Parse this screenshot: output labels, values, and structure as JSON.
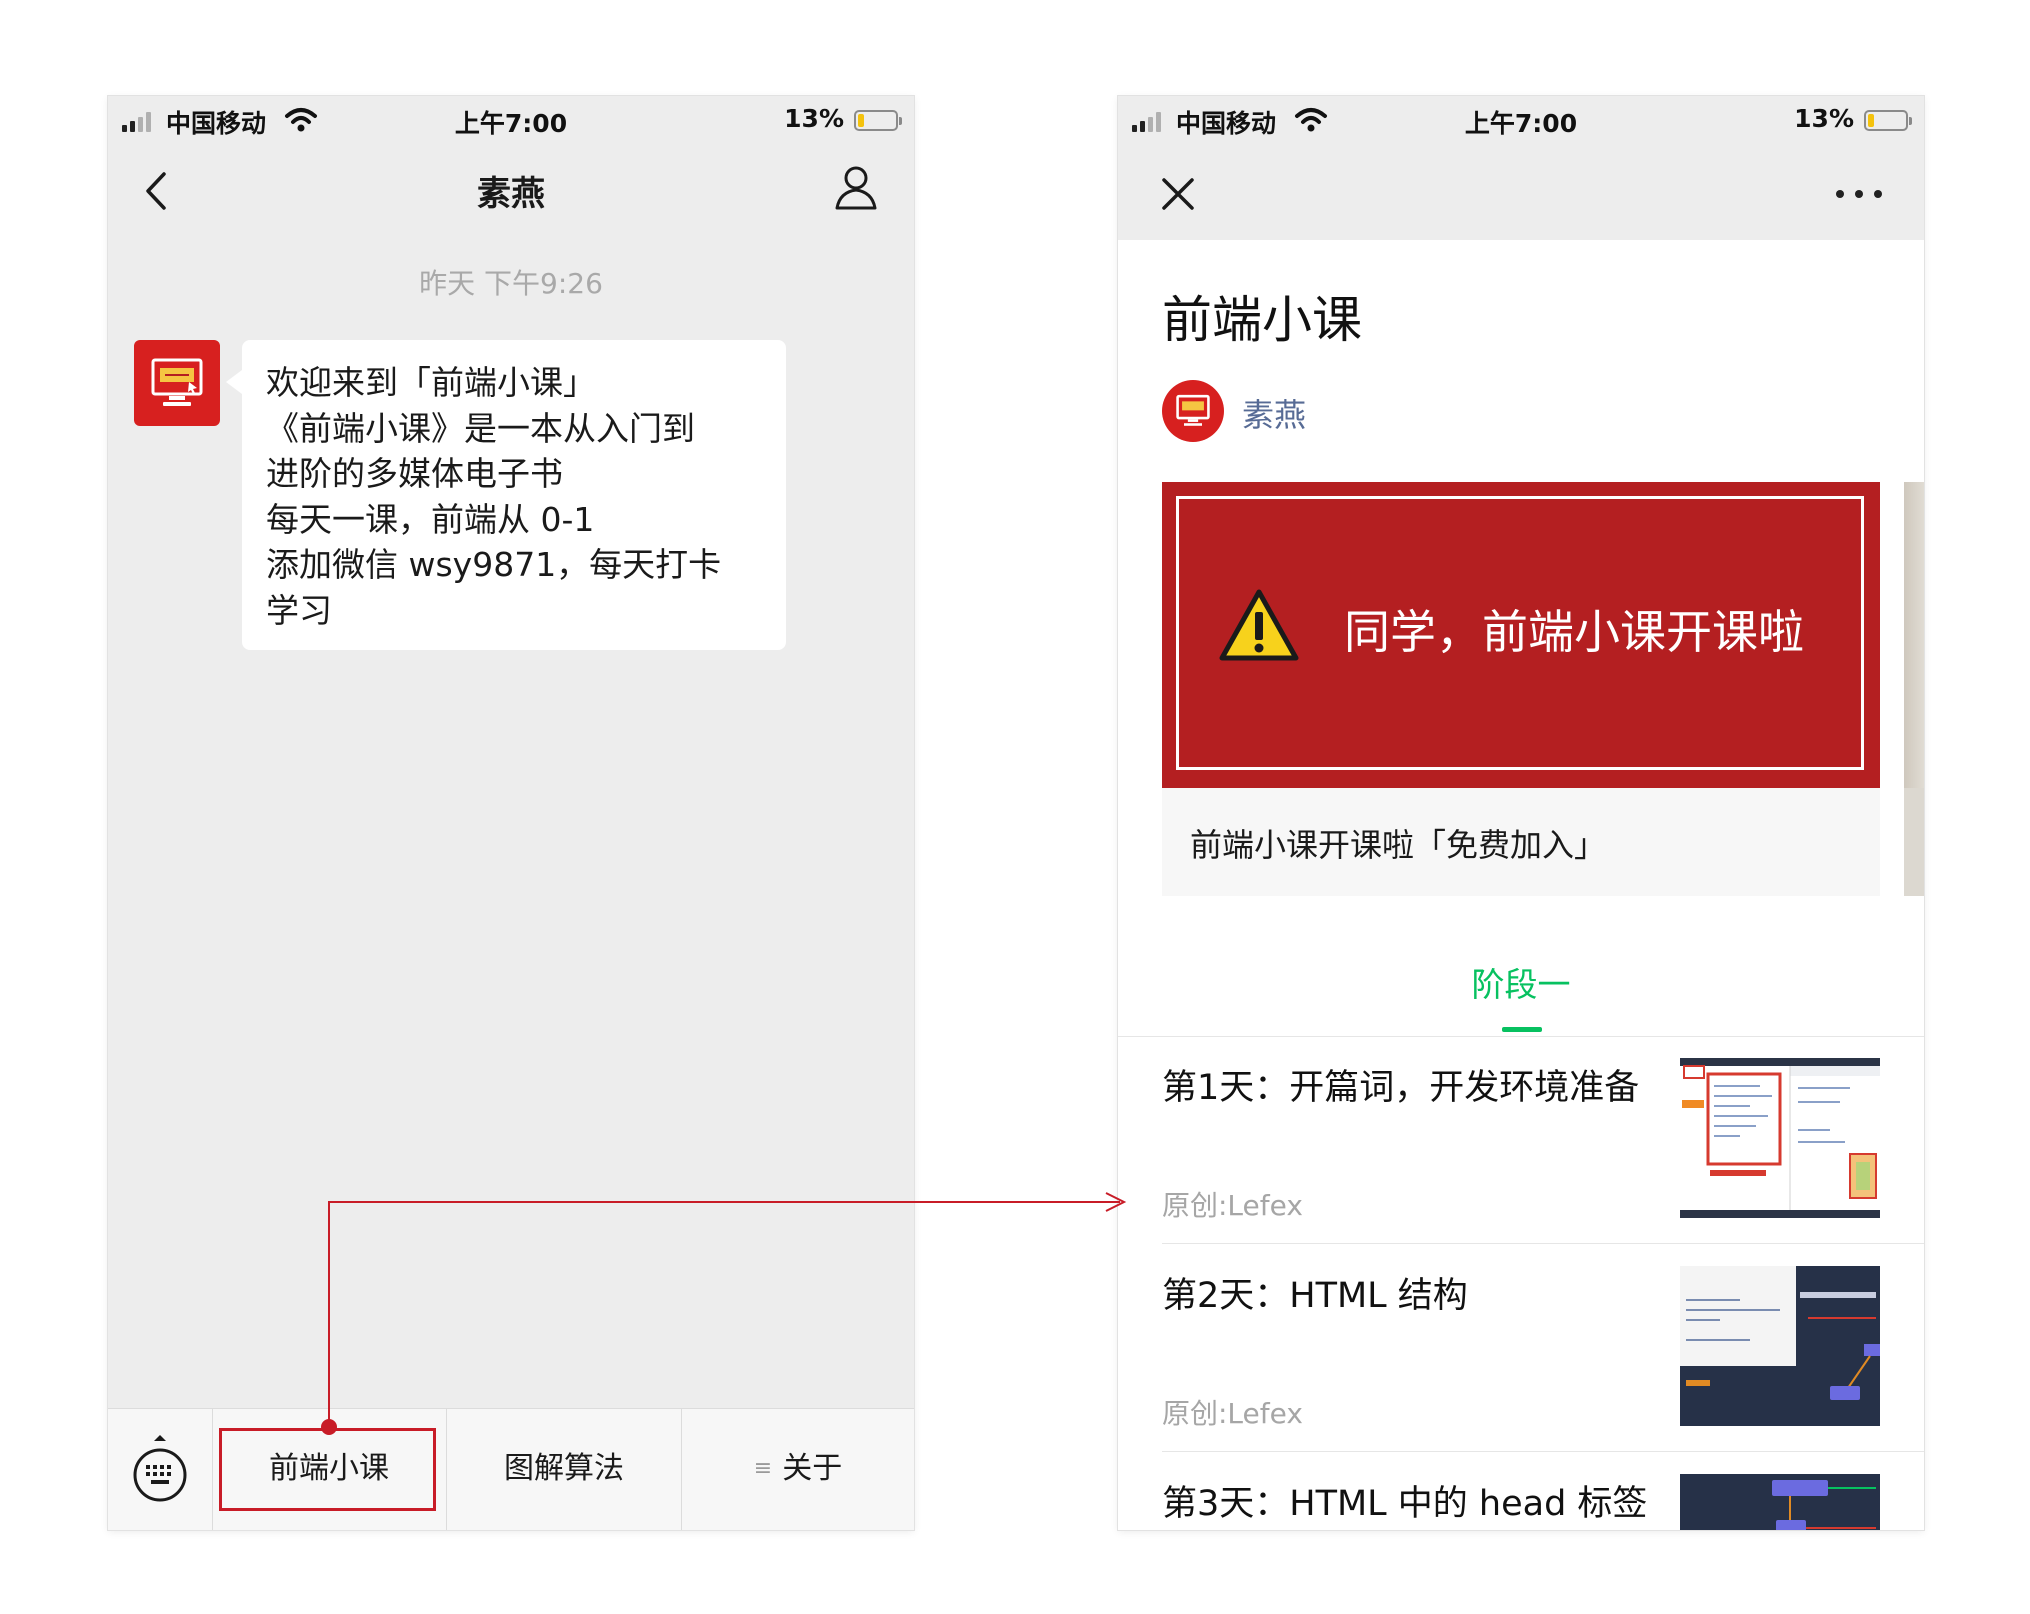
{
  "status_bar": {
    "carrier": "中国移动",
    "time": "上午7:00",
    "battery": "13%"
  },
  "chat": {
    "title": "素燕",
    "timestamp": "昨天 下午9:26",
    "message_lines": [
      "欢迎来到「前端小课」",
      "《前端小课》是一本从入门到",
      "进阶的多媒体电子书",
      "每天一课，前端从 0-1",
      "添加微信 wsy9871，每天打卡",
      "学习"
    ],
    "menu": [
      {
        "label": "前端小课"
      },
      {
        "label": "图解算法"
      },
      {
        "label": "关于",
        "icon": "≡"
      }
    ]
  },
  "album": {
    "title": "前端小课",
    "author": "素燕",
    "card": {
      "banner_text": "同学，前端小课开课啦",
      "caption": "前端小课开课啦「免费加入」"
    },
    "tab": "阶段一",
    "articles": [
      {
        "title": "第1天：开篇词，开发环境准备",
        "source": "原创:Lefex"
      },
      {
        "title": "第2天：HTML 结构",
        "source": "原创:Lefex"
      },
      {
        "title": "第3天：HTML 中的 head 标签",
        "source": ""
      }
    ]
  },
  "colors": {
    "wechat_green": "#07c160",
    "brand_red": "#d7201f",
    "annotation_red": "#c81c27",
    "author_link": "#576b95"
  }
}
